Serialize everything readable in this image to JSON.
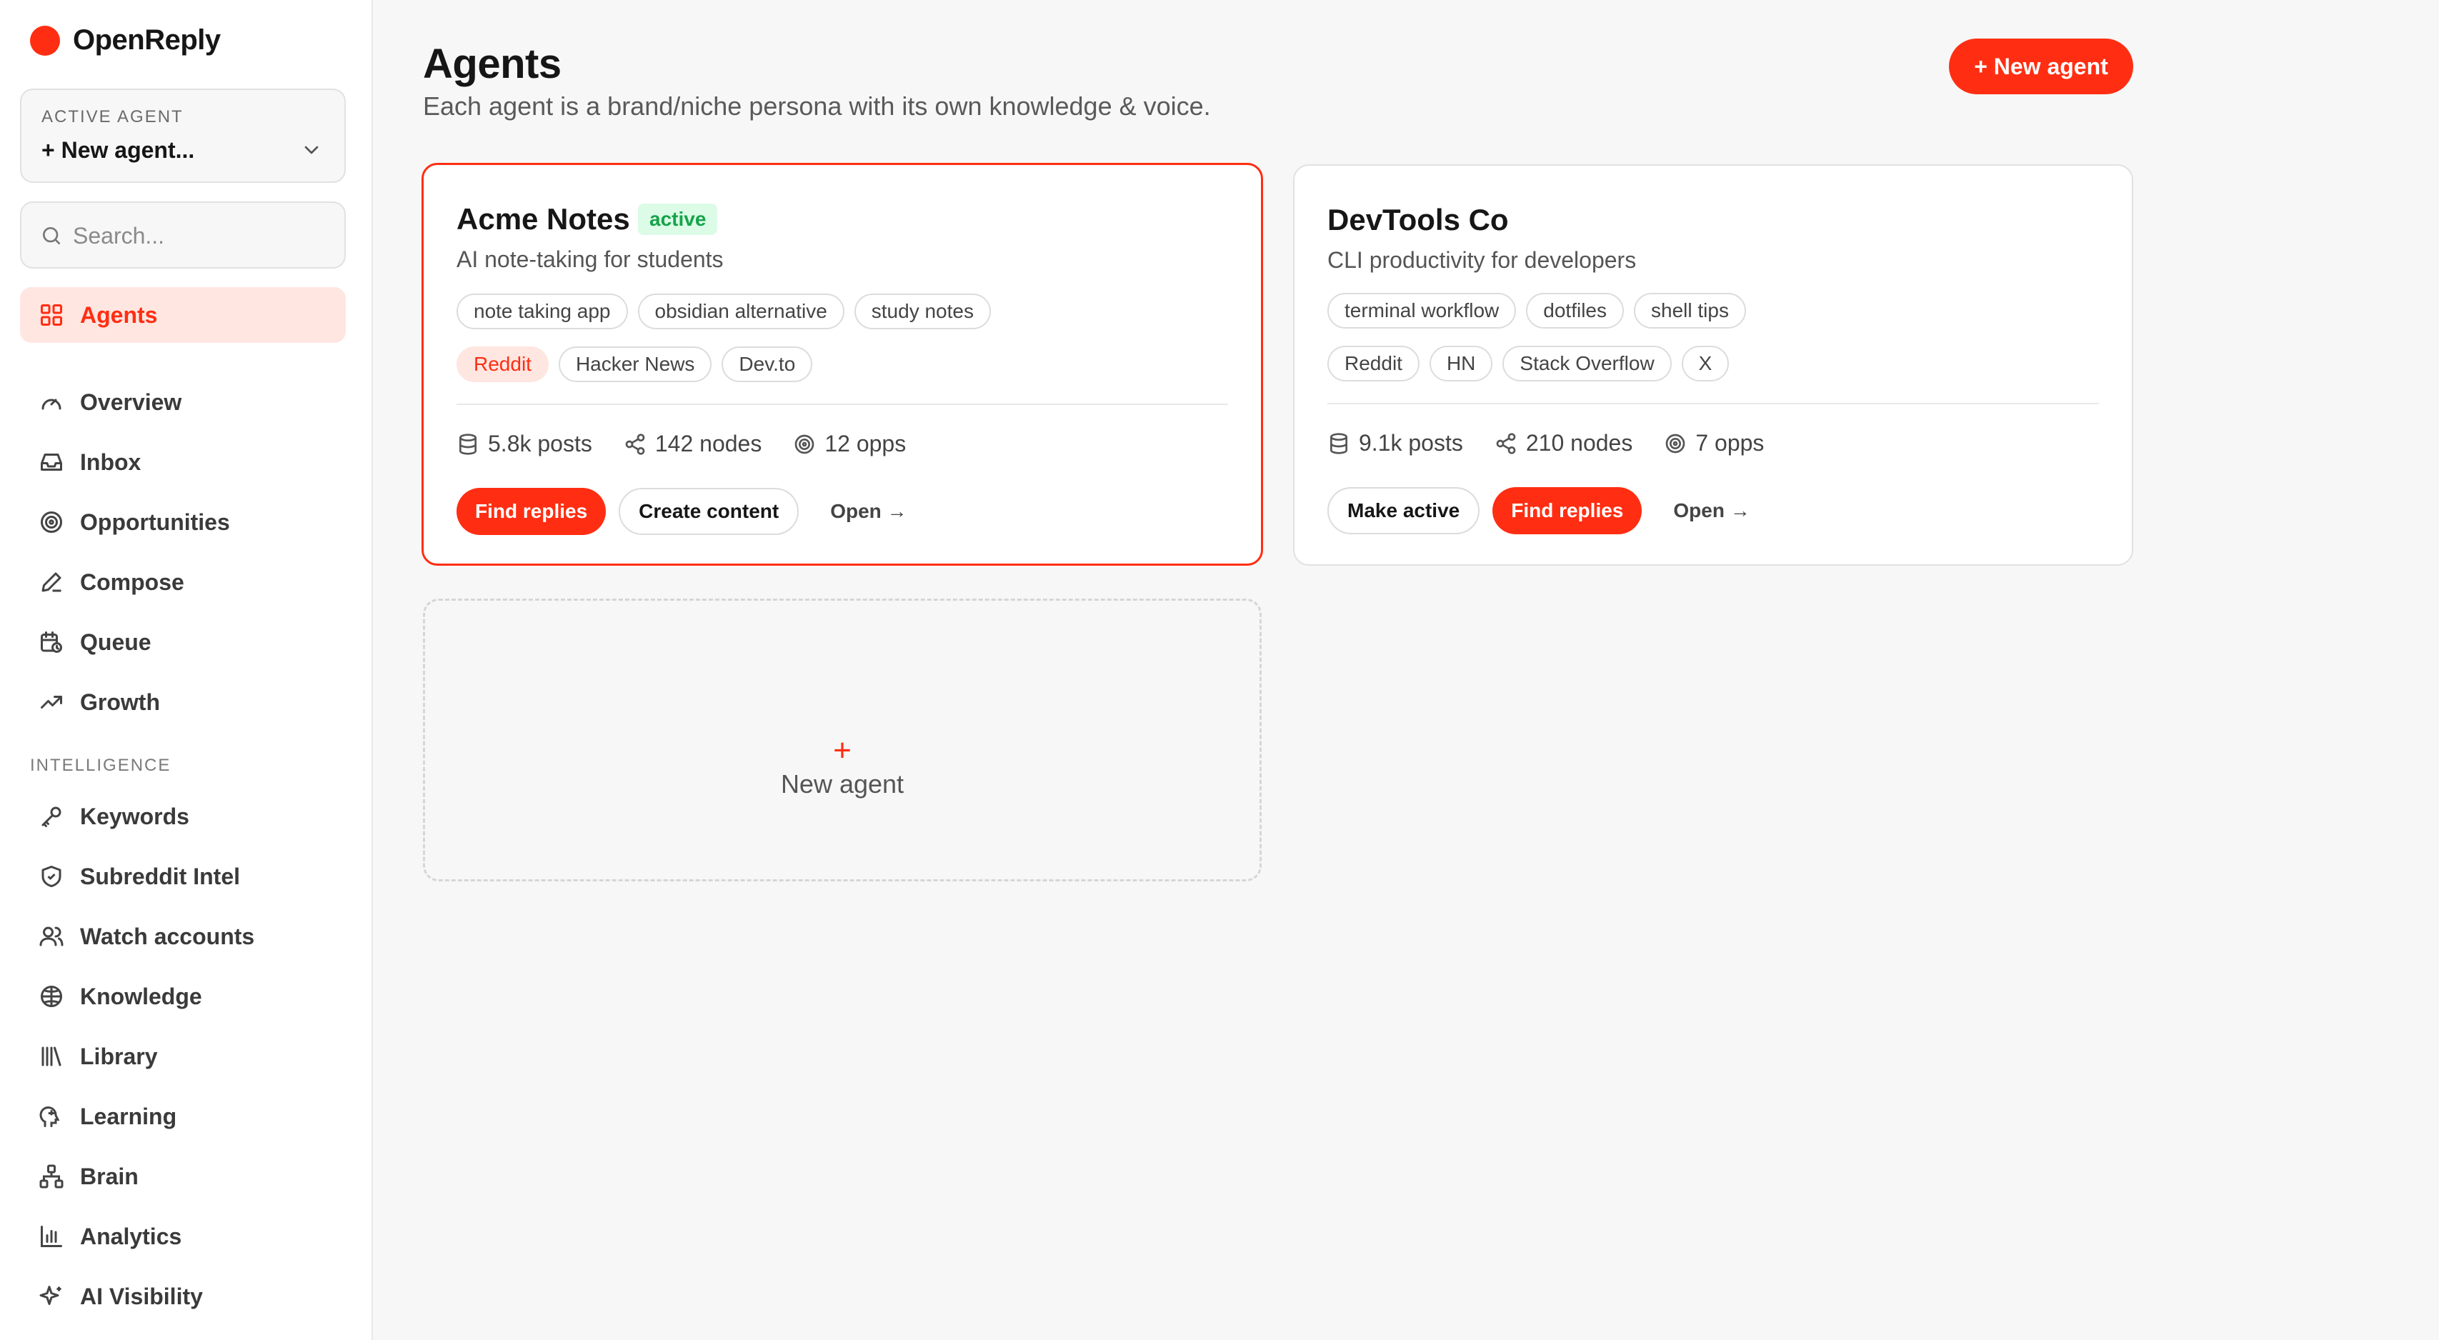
{
  "brand": {
    "name": "OpenReply",
    "color": "#ff2e12"
  },
  "sidebar": {
    "agent_select": {
      "label": "ACTIVE AGENT",
      "value": "+ New agent..."
    },
    "search_placeholder": "Search...",
    "items_top": [
      {
        "label": "Agents",
        "icon": "grid-icon",
        "active": true
      },
      {
        "label": "Overview",
        "icon": "gauge-icon"
      },
      {
        "label": "Inbox",
        "icon": "inbox-icon"
      },
      {
        "label": "Opportunities",
        "icon": "target-icon"
      },
      {
        "label": "Compose",
        "icon": "pencil-icon"
      },
      {
        "label": "Queue",
        "icon": "calendar-clock-icon"
      },
      {
        "label": "Growth",
        "icon": "trending-up-icon"
      }
    ],
    "section_label": "INTELLIGENCE",
    "items_intel": [
      {
        "label": "Keywords",
        "icon": "key-icon"
      },
      {
        "label": "Subreddit Intel",
        "icon": "shield-icon"
      },
      {
        "label": "Watch accounts",
        "icon": "users-icon"
      },
      {
        "label": "Knowledge",
        "icon": "brain-icon"
      },
      {
        "label": "Library",
        "icon": "library-icon"
      },
      {
        "label": "Learning",
        "icon": "head-icon"
      },
      {
        "label": "Brain",
        "icon": "network-icon"
      },
      {
        "label": "Analytics",
        "icon": "bar-chart-icon"
      },
      {
        "label": "AI Visibility",
        "icon": "sparkles-icon"
      }
    ]
  },
  "header": {
    "title": "Agents",
    "subtitle": "Each agent is a brand/niche persona with its own knowledge & voice.",
    "new_button": "+ New agent"
  },
  "agents": [
    {
      "name": "Acme Notes",
      "badge": "active",
      "description": "AI note-taking for students",
      "keywords": [
        "note taking app",
        "obsidian alternative",
        "study notes"
      ],
      "platforms": [
        "Reddit",
        "Hacker News",
        "Dev.to"
      ],
      "stats": {
        "posts": "5.8k posts",
        "nodes": "142 nodes",
        "opps": "12 opps"
      },
      "actions": {
        "primary": "Find replies",
        "secondary": "Create content",
        "open": "Open →"
      }
    },
    {
      "name": "DevTools Co",
      "description": "CLI productivity for developers",
      "keywords": [
        "terminal workflow",
        "dotfiles",
        "shell tips"
      ],
      "platforms": [
        "Reddit",
        "HN",
        "Stack Overflow",
        "X"
      ],
      "stats": {
        "posts": "9.1k posts",
        "nodes": "210 nodes",
        "opps": "7 opps"
      },
      "actions": {
        "secondary": "Make active",
        "primary": "Find replies",
        "open": "Open →"
      }
    }
  ],
  "new_agent_card": {
    "plus": "+",
    "label": "New agent"
  }
}
